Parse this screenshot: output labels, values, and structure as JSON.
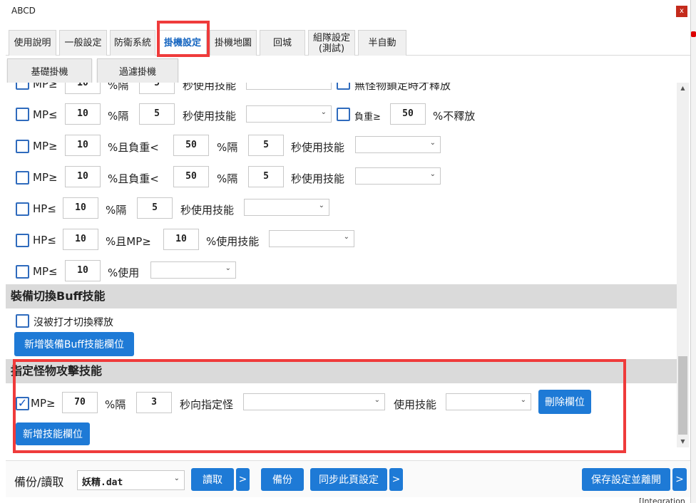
{
  "window": {
    "title": "ABCD",
    "close_label": "x"
  },
  "tabs": [
    {
      "label": "使用說明"
    },
    {
      "label": "一般設定"
    },
    {
      "label": "防衛系統"
    },
    {
      "label": "掛機設定"
    },
    {
      "label": "掛機地圖"
    },
    {
      "label": "回城"
    },
    {
      "label": "組隊設定\n(測試)"
    },
    {
      "label": "半自動"
    }
  ],
  "subtabs": [
    {
      "label": "基礎掛機"
    },
    {
      "label": "過濾掛機"
    }
  ],
  "rows": {
    "partial": {
      "mp_label": "MP≥",
      "mp_value": "10",
      "sep": "%隔",
      "interval": "5",
      "skill_label": "秒使用技能",
      "right_text": "無怪物鎖定時才釋放"
    },
    "row1": {
      "mp_label": "MP≤",
      "mp_value": "10",
      "sep": "%隔",
      "interval": "5",
      "skill_label": "秒使用技能",
      "load_label": "負重≥",
      "load_value": "50",
      "no_release": "%不釋放"
    },
    "row2": {
      "mp_label": "MP≥",
      "mp_value": "10",
      "and_load": "%且負重<",
      "load_value": "50",
      "sep": "%隔",
      "interval": "5",
      "skill_label": "秒使用技能"
    },
    "row3": {
      "mp_label": "MP≥",
      "mp_value": "10",
      "and_load": "%且負重<",
      "load_value": "50",
      "sep": "%隔",
      "interval": "5",
      "skill_label": "秒使用技能"
    },
    "row4": {
      "hp_label": "HP≤",
      "hp_value": "10",
      "sep": "%隔",
      "interval": "5",
      "skill_label": "秒使用技能"
    },
    "row5": {
      "hp_label": "HP≤",
      "hp_value": "10",
      "and_mp": "%且MP≥",
      "mp_value": "10",
      "skill_label": "%使用技能"
    },
    "row6": {
      "mp_label": "MP≤",
      "mp_value": "10",
      "use_label": "%使用"
    }
  },
  "buff_section": {
    "title": "裝備切換Buff技能",
    "checkbox_label": "沒被打才切換釋放",
    "add_button": "新增裝備Buff技能欄位"
  },
  "monster_section": {
    "title": "指定怪物攻擊技能",
    "mp_label": "MP≥",
    "mp_value": "70",
    "sep": "%隔",
    "interval": "3",
    "target_label": "秒向指定怪",
    "use_label": "使用技能",
    "delete_button": "刪除欄位",
    "add_button": "新增技能欄位"
  },
  "footer": {
    "backup_label": "備份/讀取",
    "file_value": "妖精.dat",
    "read_button": "讀取",
    "backup_button": "備份",
    "sync_button": "同步此頁設定",
    "save_button": "保存設定並離開",
    "more": ">"
  },
  "bottom_fragment": "[Integration"
}
